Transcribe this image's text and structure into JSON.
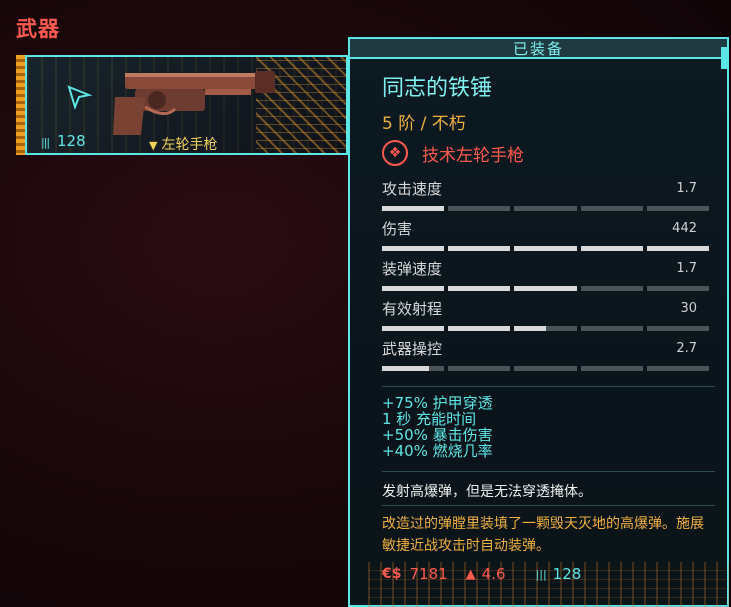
{
  "section": {
    "title": "武器"
  },
  "slot": {
    "ammo": "128",
    "weapon_type": "左轮手枪",
    "icons": {
      "cursor": "cursor-arrow-icon",
      "ammo": "ammo-icon",
      "type": "revolver-type-icon"
    }
  },
  "tooltip": {
    "header": "已装备",
    "name": "同志的铁锤",
    "tier": "5 阶 / 不朽",
    "type_label": "技术左轮手枪",
    "type_icon": "tech-weapon-icon",
    "stats": [
      {
        "label": "攻击速度",
        "value": "1.7",
        "fill": 0.2
      },
      {
        "label": "伤害",
        "value": "442",
        "fill": 1.0
      },
      {
        "label": "装弹速度",
        "value": "1.7",
        "fill": 0.6
      },
      {
        "label": "有效射程",
        "value": "30",
        "fill": 0.5
      },
      {
        "label": "武器操控",
        "value": "2.7",
        "fill": 0.15
      }
    ],
    "mods": [
      "+75% 护甲穿透",
      "1 秒 充能时间",
      "+50% 暴击伤害",
      "+40% 燃烧几率"
    ],
    "effect": "发射高爆弹，但是无法穿透掩体。",
    "flavor": "改造过的弹膛里装填了一颗毁天灭地的高爆弹。施展敏捷近战攻击时自动装弹。",
    "footer": {
      "price": "7181",
      "weight": "4.6",
      "ammo": "128"
    }
  },
  "colors": {
    "accent": "#5de6e6",
    "red": "#ff5a4e",
    "gold": "#f0b040"
  }
}
